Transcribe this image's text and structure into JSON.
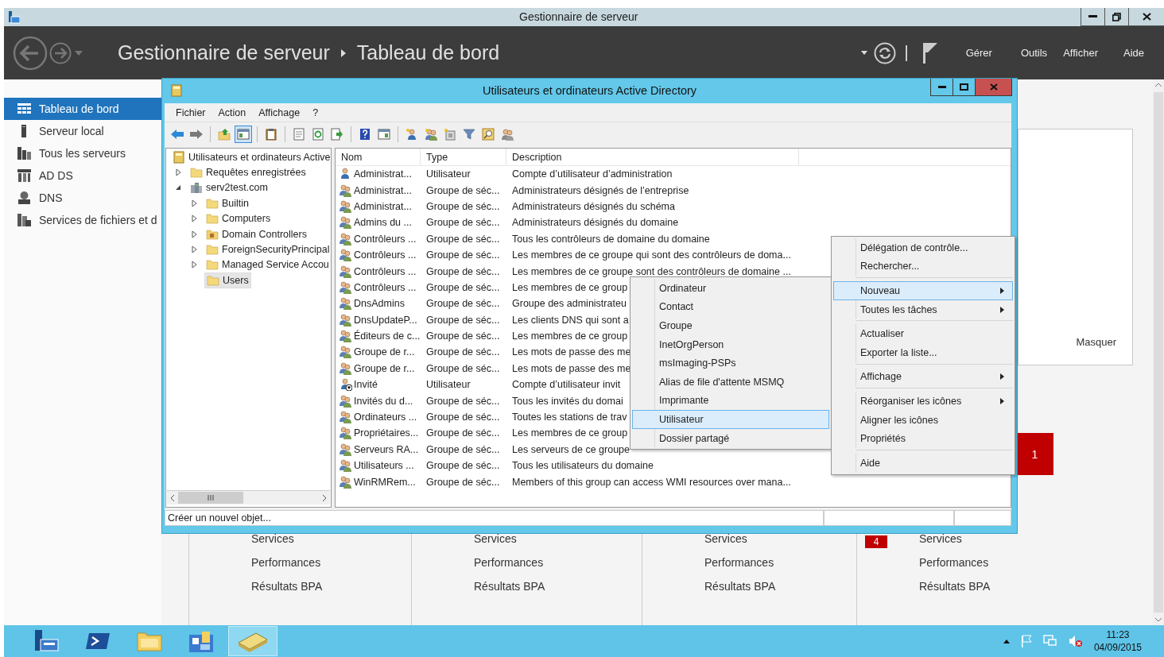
{
  "window": {
    "title": "Gestionnaire de serveur"
  },
  "header": {
    "breadcrumb": [
      "Gestionnaire de serveur",
      "Tableau de bord"
    ],
    "menus": [
      "Gérer",
      "Outils",
      "Afficher",
      "Aide"
    ]
  },
  "sidebar": {
    "items": [
      {
        "label": "Tableau de bord",
        "kind": "dashboard",
        "selected": true
      },
      {
        "label": "Serveur local",
        "kind": "server",
        "selected": false
      },
      {
        "label": "Tous les serveurs",
        "kind": "servers",
        "selected": false
      },
      {
        "label": "AD DS",
        "kind": "adds",
        "selected": false
      },
      {
        "label": "DNS",
        "kind": "dns",
        "selected": false
      },
      {
        "label": "Services de fichiers et d",
        "kind": "files",
        "selected": false
      }
    ]
  },
  "dashboard": {
    "hide_label": "Masquer",
    "alert_count": "1",
    "columns": [
      {
        "links": [
          "Services",
          "Performances",
          "Résultats BPA"
        ]
      },
      {
        "links": [
          "Services",
          "Performances",
          "Résultats BPA"
        ]
      },
      {
        "links": [
          "Services",
          "Performances",
          "Résultats BPA"
        ]
      },
      {
        "badge": "4",
        "links": [
          "Services",
          "Performances",
          "Résultats BPA"
        ]
      }
    ]
  },
  "aduc": {
    "title": "Utilisateurs et ordinateurs Active Directory",
    "menu": [
      "Fichier",
      "Action",
      "Affichage",
      "?"
    ],
    "toolbar": [
      [
        {
          "kind": "back",
          "pressed": false
        },
        {
          "kind": "forward",
          "pressed": false
        }
      ],
      [
        {
          "kind": "up",
          "pressed": false
        },
        {
          "kind": "tree",
          "pressed": true
        }
      ],
      [
        {
          "kind": "clipboard",
          "pressed": false
        }
      ],
      [
        {
          "kind": "properties",
          "pressed": false
        },
        {
          "kind": "refresh",
          "pressed": false
        },
        {
          "kind": "export",
          "pressed": false
        }
      ],
      [
        {
          "kind": "help",
          "pressed": false
        },
        {
          "kind": "pane",
          "pressed": false
        }
      ],
      [
        {
          "kind": "newuser",
          "pressed": false
        },
        {
          "kind": "newgroup",
          "pressed": false
        },
        {
          "kind": "newou",
          "pressed": false
        },
        {
          "kind": "filter",
          "pressed": false
        },
        {
          "kind": "find",
          "pressed": false
        },
        {
          "kind": "addgroup",
          "pressed": false
        }
      ]
    ],
    "tree": [
      {
        "label": "Utilisateurs et ordinateurs Active",
        "kind": "root",
        "selected": false,
        "children": [
          {
            "label": "Requêtes enregistrées",
            "kind": "folder",
            "has_children": true,
            "expanded": false,
            "selected": false
          },
          {
            "label": "serv2test.com",
            "kind": "domain",
            "has_children": true,
            "expanded": true,
            "selected": false,
            "children": [
              {
                "label": "Builtin",
                "kind": "folder",
                "has_children": true,
                "expanded": false,
                "selected": false
              },
              {
                "label": "Computers",
                "kind": "folder",
                "has_children": true,
                "expanded": false,
                "selected": false
              },
              {
                "label": "Domain Controllers",
                "kind": "ou",
                "has_children": true,
                "expanded": false,
                "selected": false
              },
              {
                "label": "ForeignSecurityPrincipal",
                "kind": "folder",
                "has_children": true,
                "expanded": false,
                "selected": false
              },
              {
                "label": "Managed Service Accou",
                "kind": "folder",
                "has_children": true,
                "expanded": false,
                "selected": false
              },
              {
                "label": "Users",
                "kind": "folder",
                "has_children": false,
                "expanded": false,
                "selected": true
              }
            ]
          }
        ]
      }
    ],
    "columns": [
      "Nom",
      "Type",
      "Description"
    ],
    "rows": [
      {
        "kind": "user",
        "disabled": false,
        "name": "Administrat...",
        "type": "Utilisateur",
        "description": "Compte d’utilisateur d’administration"
      },
      {
        "kind": "group",
        "disabled": false,
        "name": "Administrat...",
        "type": "Groupe de séc...",
        "description": "Administrateurs désignés de l’entreprise"
      },
      {
        "kind": "group",
        "disabled": false,
        "name": "Administrat...",
        "type": "Groupe de séc...",
        "description": "Administrateurs désignés du schéma"
      },
      {
        "kind": "group",
        "disabled": false,
        "name": "Admins du ...",
        "type": "Groupe de séc...",
        "description": "Administrateurs désignés du domaine"
      },
      {
        "kind": "group",
        "disabled": false,
        "name": "Contrôleurs ...",
        "type": "Groupe de séc...",
        "description": "Tous les contrôleurs de domaine du domaine"
      },
      {
        "kind": "group",
        "disabled": false,
        "name": "Contrôleurs ...",
        "type": "Groupe de séc...",
        "description": "Les membres de ce groupe qui sont des contrôleurs de doma..."
      },
      {
        "kind": "group",
        "disabled": false,
        "name": "Contrôleurs ...",
        "type": "Groupe de séc...",
        "description": "Les membres de ce groupe sont des contrôleurs de domaine ..."
      },
      {
        "kind": "group",
        "disabled": false,
        "name": "Contrôleurs ...",
        "type": "Groupe de séc...",
        "description": "Les membres de ce group"
      },
      {
        "kind": "group",
        "disabled": false,
        "name": "DnsAdmins",
        "type": "Groupe de séc...",
        "description": "Groupe des administrateu"
      },
      {
        "kind": "group",
        "disabled": false,
        "name": "DnsUpdateP...",
        "type": "Groupe de séc...",
        "description": "Les clients DNS qui sont a"
      },
      {
        "kind": "group",
        "disabled": false,
        "name": "Éditeurs de c...",
        "type": "Groupe de séc...",
        "description": "Les membres de ce group"
      },
      {
        "kind": "group",
        "disabled": false,
        "name": "Groupe de r...",
        "type": "Groupe de séc...",
        "description": "Les mots de passe des me"
      },
      {
        "kind": "group",
        "disabled": false,
        "name": "Groupe de r...",
        "type": "Groupe de séc...",
        "description": "Les mots de passe des me"
      },
      {
        "kind": "user",
        "disabled": true,
        "name": "Invité",
        "type": "Utilisateur",
        "description": "Compte d’utilisateur invit"
      },
      {
        "kind": "group",
        "disabled": false,
        "name": "Invités du d...",
        "type": "Groupe de séc...",
        "description": "Tous les invités du domai"
      },
      {
        "kind": "group",
        "disabled": false,
        "name": "Ordinateurs ...",
        "type": "Groupe de séc...",
        "description": "Toutes les stations de trav"
      },
      {
        "kind": "group",
        "disabled": false,
        "name": "Propriétaires...",
        "type": "Groupe de séc...",
        "description": "Les membres de ce group"
      },
      {
        "kind": "group",
        "disabled": false,
        "name": "Serveurs RA...",
        "type": "Groupe de séc...",
        "description": "Les serveurs de ce groupe"
      },
      {
        "kind": "group",
        "disabled": false,
        "name": "Utilisateurs ...",
        "type": "Groupe de séc...",
        "description": "Tous les utilisateurs du domaine"
      },
      {
        "kind": "group",
        "disabled": false,
        "name": "WinRMRem...",
        "type": "Groupe de séc...",
        "description": "Members of this group can access WMI resources over mana..."
      }
    ],
    "status": "Créer un nouvel objet..."
  },
  "context_menu": {
    "items": [
      {
        "kind": "item",
        "label": "Délégation de contrôle...",
        "submenu": false,
        "selected": false
      },
      {
        "kind": "item",
        "label": "Rechercher...",
        "submenu": false,
        "selected": false
      },
      {
        "kind": "separator"
      },
      {
        "kind": "item",
        "label": "Nouveau",
        "submenu": true,
        "selected": true
      },
      {
        "kind": "item",
        "label": "Toutes les tâches",
        "submenu": true,
        "selected": false
      },
      {
        "kind": "separator"
      },
      {
        "kind": "item",
        "label": "Actualiser",
        "submenu": false,
        "selected": false
      },
      {
        "kind": "item",
        "label": "Exporter la liste...",
        "submenu": false,
        "selected": false
      },
      {
        "kind": "separator"
      },
      {
        "kind": "item",
        "label": "Affichage",
        "submenu": true,
        "selected": false
      },
      {
        "kind": "separator"
      },
      {
        "kind": "item",
        "label": "Réorganiser les icônes",
        "submenu": true,
        "selected": false
      },
      {
        "kind": "item",
        "label": "Aligner les icônes",
        "submenu": false,
        "selected": false
      },
      {
        "kind": "item",
        "label": "Propriétés",
        "submenu": false,
        "selected": false
      },
      {
        "kind": "separator"
      },
      {
        "kind": "item",
        "label": "Aide",
        "submenu": false,
        "selected": false
      }
    ]
  },
  "submenu": {
    "items": [
      {
        "label": "Ordinateur",
        "selected": false
      },
      {
        "label": "Contact",
        "selected": false
      },
      {
        "label": "Groupe",
        "selected": false
      },
      {
        "label": "InetOrgPerson",
        "selected": false
      },
      {
        "label": "msImaging-PSPs",
        "selected": false
      },
      {
        "label": "Alias de file d'attente MSMQ",
        "selected": false
      },
      {
        "label": "Imprimante",
        "selected": false
      },
      {
        "label": "Utilisateur",
        "selected": true
      },
      {
        "label": "Dossier partagé",
        "selected": false
      }
    ]
  },
  "taskbar": {
    "apps": [
      {
        "kind": "servermanager",
        "selected": false
      },
      {
        "kind": "powershell",
        "selected": false
      },
      {
        "kind": "explorer",
        "selected": false
      },
      {
        "kind": "adtools",
        "selected": false
      },
      {
        "kind": "notebook",
        "selected": true
      }
    ],
    "time": "11:23",
    "date": "04/09/2015"
  }
}
